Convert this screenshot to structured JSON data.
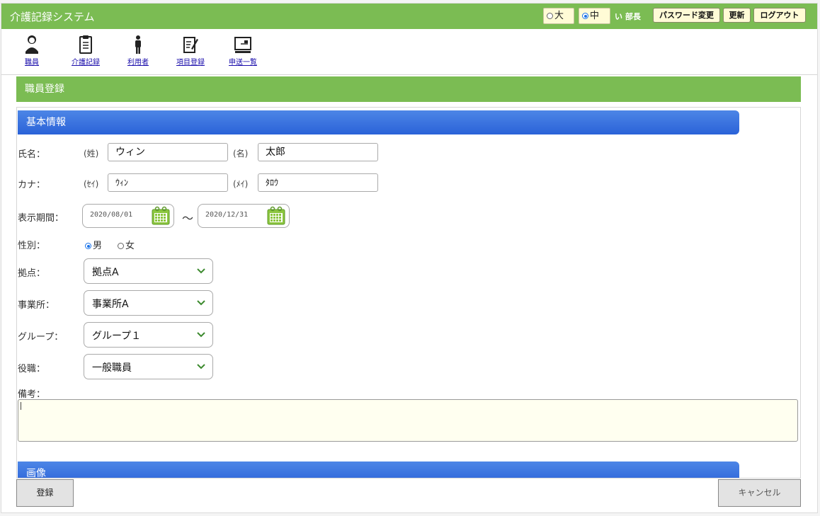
{
  "app": {
    "title": "介護記録システム"
  },
  "header": {
    "font_size_large": "大",
    "font_size_medium": "中",
    "user": "い 部長",
    "password_button": "パスワード変更",
    "refresh_button": "更新",
    "logout_button": "ログアウト"
  },
  "nav": {
    "items": [
      {
        "label": "職員",
        "icon": "staff-icon"
      },
      {
        "label": "介護記録",
        "icon": "clipboard-icon"
      },
      {
        "label": "利用者",
        "icon": "person-icon"
      },
      {
        "label": "項目登録",
        "icon": "edit-icon"
      },
      {
        "label": "申送一覧",
        "icon": "monitor-icon"
      }
    ]
  },
  "page": {
    "title": "職員登録"
  },
  "basic": {
    "section_title": "基本情報",
    "name_label": "氏名：",
    "sei_label": "(姓)",
    "sei_value": "ウィン",
    "mei_label": "(名)",
    "mei_value": "太郎",
    "kana_label": "カナ：",
    "sei_kana_label": "(ｾｲ)",
    "sei_kana_value": "ｳｨﾝ",
    "mei_kana_label": "(ﾒｲ)",
    "mei_kana_value": "ﾀﾛｳ",
    "period_label": "表示期間：",
    "period_start": "2020/08/01",
    "period_sep": "～",
    "period_end": "2020/12/31",
    "gender_label": "性別：",
    "gender_male": "男",
    "gender_female": "女",
    "gender_selected": "男",
    "base_label": "拠点：",
    "base_value": "拠点A",
    "office_label": "事業所：",
    "office_value": "事業所A",
    "group_label": "グループ：",
    "group_value": "グループ１",
    "position_label": "役職：",
    "position_value": "一般職員",
    "remarks_label": "備考："
  },
  "image": {
    "section_title": "画像"
  },
  "footer": {
    "save_button": "登録",
    "cancel_button": "キャンセル"
  },
  "colors": {
    "green": "#7bbc53",
    "blue": "#3b74e0",
    "input_bg": "#fffff0"
  }
}
